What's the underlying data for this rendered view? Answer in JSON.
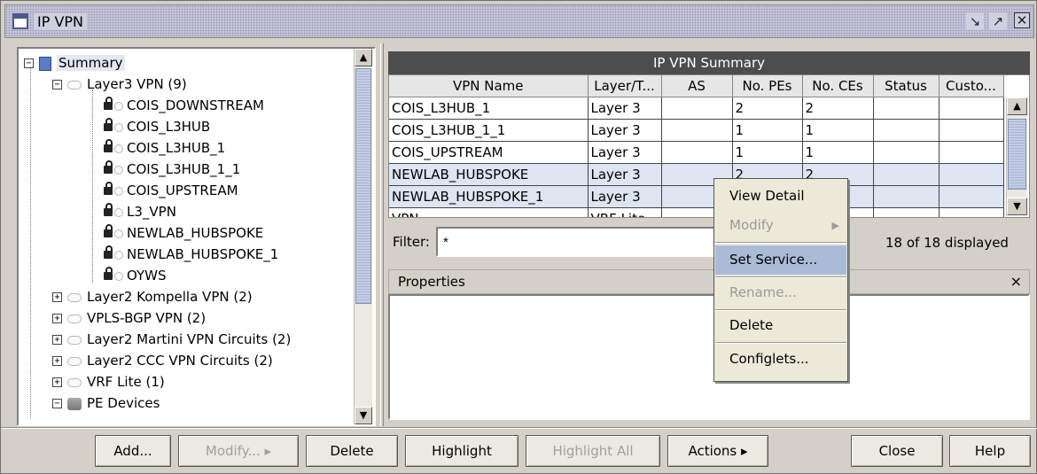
{
  "window": {
    "title": "IP VPN",
    "buttons": {
      "restore_icon": "restore-icon",
      "maximize_icon": "maximize-icon",
      "close_icon": "close-icon"
    }
  },
  "tree": {
    "root": "Summary",
    "items": [
      {
        "label": "Layer3 VPN (9)",
        "expanded": true
      },
      {
        "label": "COIS_DOWNSTREAM"
      },
      {
        "label": "COIS_L3HUB"
      },
      {
        "label": "COIS_L3HUB_1"
      },
      {
        "label": "COIS_L3HUB_1_1"
      },
      {
        "label": "COIS_UPSTREAM"
      },
      {
        "label": "L3_VPN"
      },
      {
        "label": "NEWLAB_HUBSPOKE"
      },
      {
        "label": "NEWLAB_HUBSPOKE_1"
      },
      {
        "label": "OYWS"
      },
      {
        "label": "Layer2 Kompella VPN (2)"
      },
      {
        "label": "VPLS-BGP VPN (2)"
      },
      {
        "label": "Layer2 Martini VPN Circuits (2)"
      },
      {
        "label": "Layer2 CCC VPN Circuits (2)"
      },
      {
        "label": "VRF Lite (1)"
      },
      {
        "label": "PE Devices"
      }
    ]
  },
  "summary": {
    "title": "IP VPN Summary",
    "columns": [
      "VPN Name",
      "Layer/T...",
      "AS",
      "No. PEs",
      "No. CEs",
      "Status",
      "Custo..."
    ],
    "rows": [
      [
        "COIS_L3HUB_1",
        "Layer 3",
        "",
        "2",
        "2",
        "",
        ""
      ],
      [
        "COIS_L3HUB_1_1",
        "Layer 3",
        "",
        "1",
        "1",
        "",
        ""
      ],
      [
        "COIS_UPSTREAM",
        "Layer 3",
        "",
        "1",
        "1",
        "",
        ""
      ],
      [
        "NEWLAB_HUBSPOKE",
        "Layer 3",
        "",
        "2",
        "2",
        "",
        ""
      ],
      [
        "NEWLAB_HUBSPOKE_1",
        "Layer 3",
        "",
        "",
        "",
        "",
        ""
      ],
      [
        "VPN",
        "VRF Lite",
        "",
        "",
        "",
        "",
        ""
      ]
    ],
    "filter_label": "Filter:",
    "filter_value": "*",
    "displayed": "18 of 18 displayed"
  },
  "properties": {
    "title": "Properties",
    "close": "×"
  },
  "context_menu": {
    "items": [
      {
        "label": "View Detail",
        "enabled": true
      },
      {
        "label": "Modify",
        "enabled": false,
        "submenu": true
      },
      {
        "label": "Set Service...",
        "enabled": true,
        "highlighted": true
      },
      {
        "label": "Rename...",
        "enabled": false
      },
      {
        "label": "Delete",
        "enabled": true
      },
      {
        "label": "Configlets...",
        "enabled": true
      }
    ]
  },
  "buttons": {
    "add": "Add...",
    "modify": "Modify... ▸",
    "delete": "Delete",
    "highlight": "Highlight",
    "highlight_all": "Highlight All",
    "actions": "Actions ▸",
    "close": "Close",
    "help": "Help"
  }
}
